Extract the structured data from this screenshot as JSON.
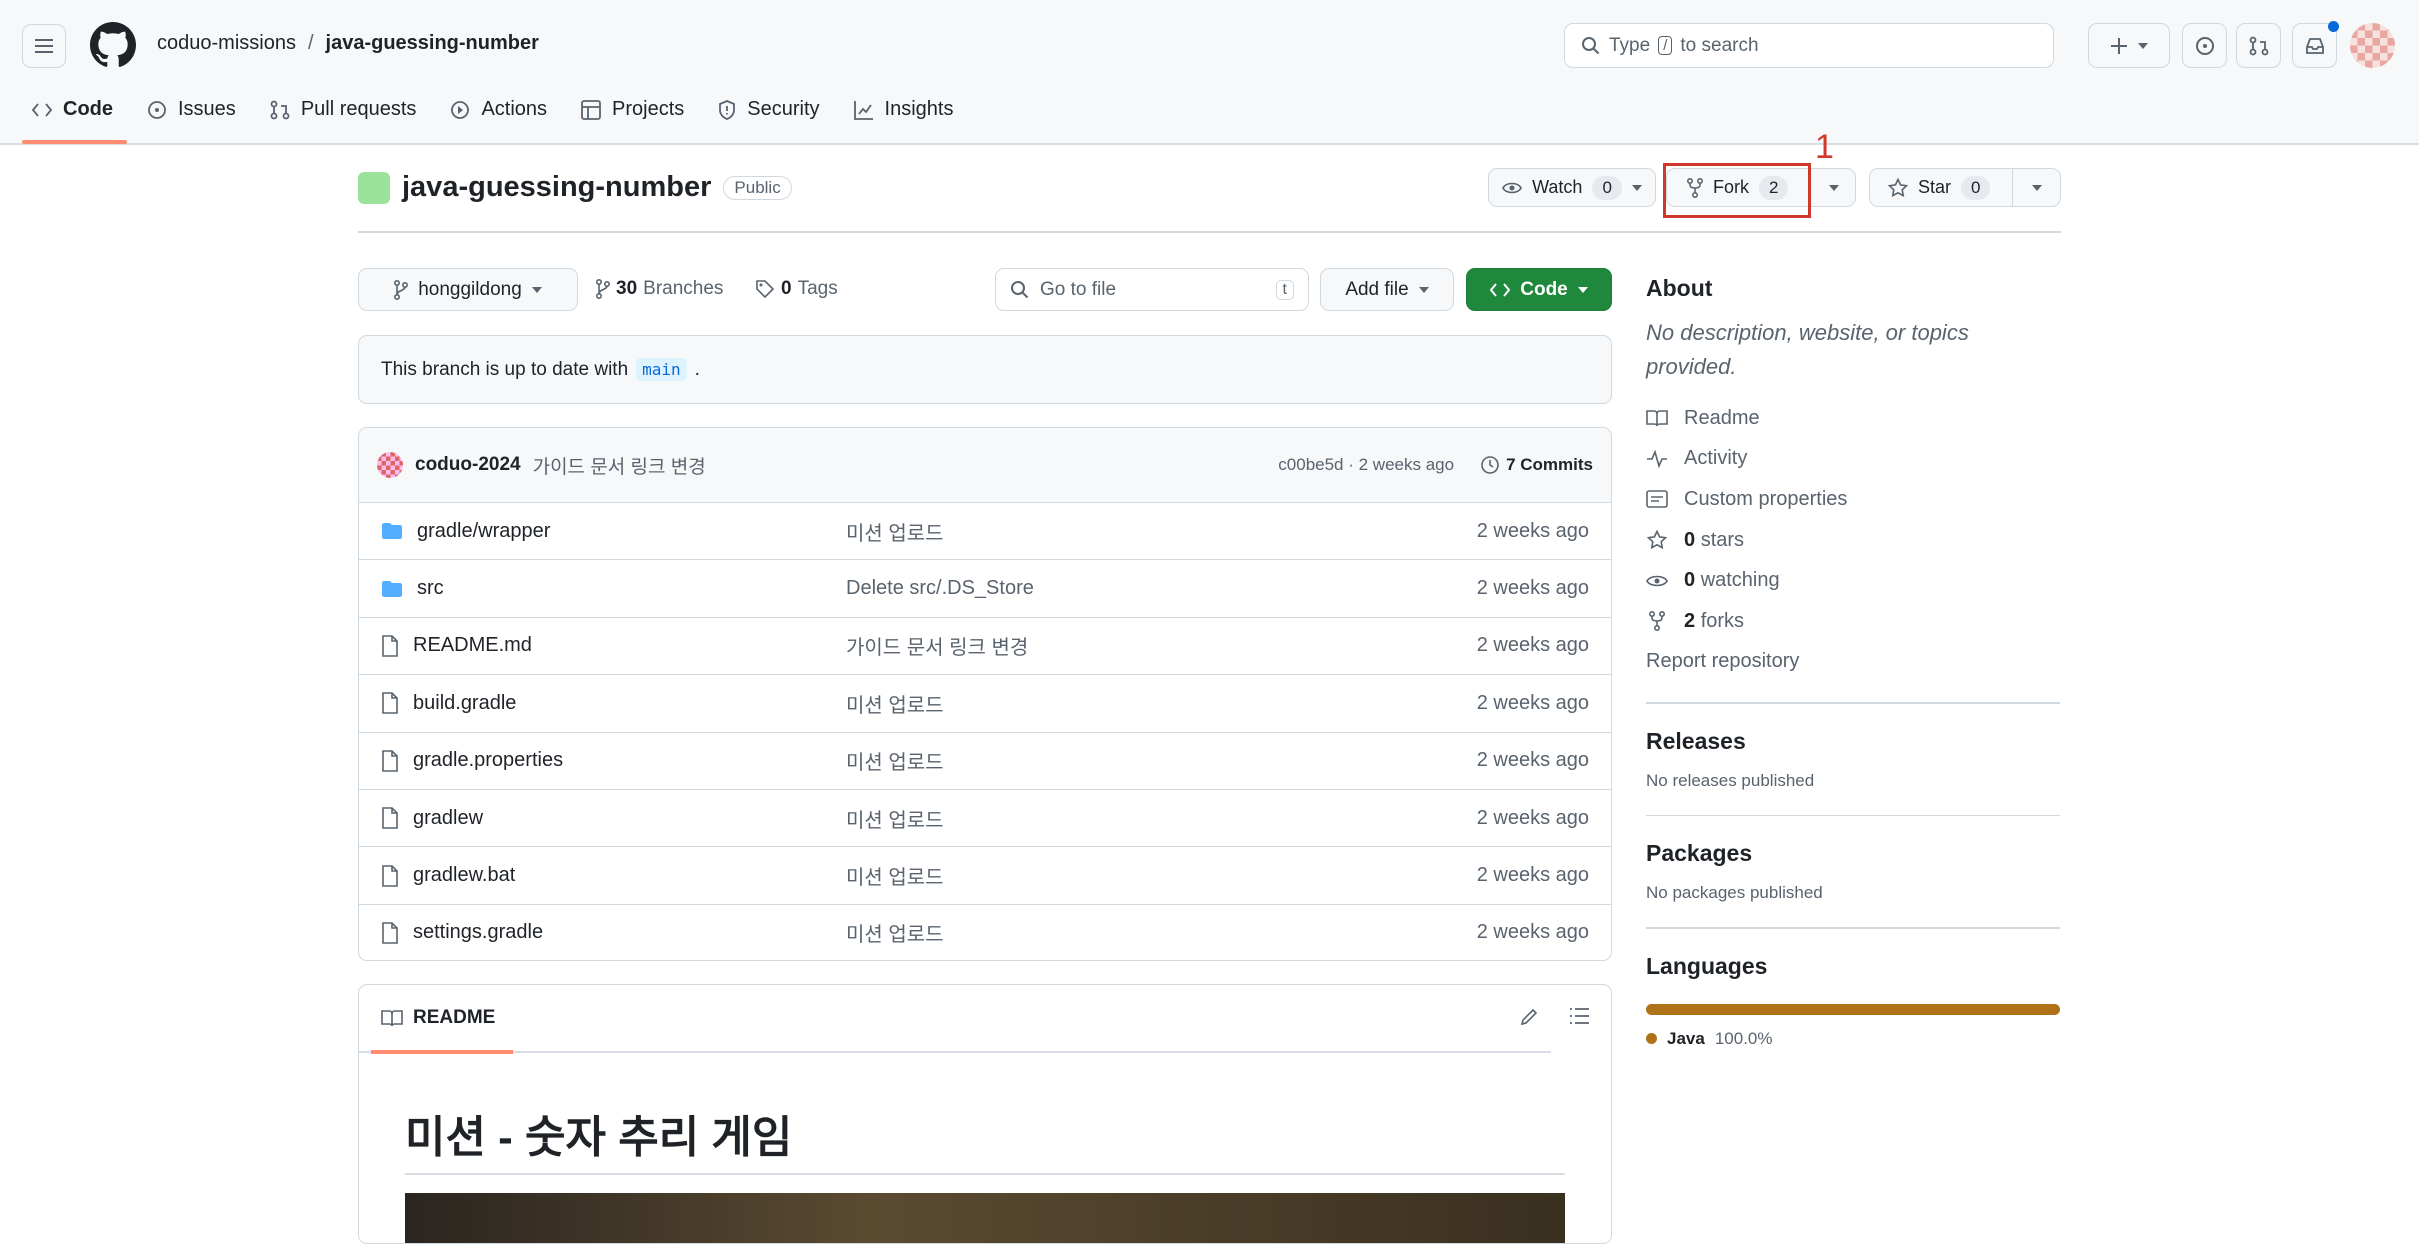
{
  "header": {
    "owner": "coduo-missions",
    "separator": "/",
    "repo": "java-guessing-number",
    "search_placeholder": "Type / to search",
    "search_prefix": "Type",
    "search_key": "/",
    "search_suffix": "to search"
  },
  "tabs": [
    {
      "label": "Code",
      "icon": "code-icon"
    },
    {
      "label": "Issues",
      "icon": "issue-icon"
    },
    {
      "label": "Pull requests",
      "icon": "pull-request-icon"
    },
    {
      "label": "Actions",
      "icon": "play-icon"
    },
    {
      "label": "Projects",
      "icon": "table-icon"
    },
    {
      "label": "Security",
      "icon": "shield-icon"
    },
    {
      "label": "Insights",
      "icon": "graph-icon"
    }
  ],
  "repo": {
    "name": "java-guessing-number",
    "visibility": "Public",
    "watch_label": "Watch",
    "watch_count": "0",
    "fork_label": "Fork",
    "fork_count": "2",
    "star_label": "Star",
    "star_count": "0",
    "annotation": "1",
    "highlight_color": "#d0382b"
  },
  "toolbar": {
    "branch": "honggildong",
    "branches_count": "30",
    "branches_label": "Branches",
    "tags_count": "0",
    "tags_label": "Tags",
    "goto_placeholder": "Go to file",
    "goto_key": "t",
    "add_file": "Add file",
    "code": "Code"
  },
  "banner": {
    "text": "This branch is up to date with",
    "branch": "main",
    "end": "."
  },
  "commit": {
    "author": "coduo-2024",
    "message": "가이드 문서 링크 변경",
    "hash_age": "c00be5d · 2 weeks ago",
    "commits": "7 Commits"
  },
  "files": [
    {
      "name": "gradle/wrapper",
      "type": "folder",
      "message": "미션 업로드",
      "age": "2 weeks ago"
    },
    {
      "name": "src",
      "type": "folder",
      "message": "Delete src/.DS_Store",
      "age": "2 weeks ago"
    },
    {
      "name": "README.md",
      "type": "file",
      "message": "가이드 문서 링크 변경",
      "age": "2 weeks ago"
    },
    {
      "name": "build.gradle",
      "type": "file",
      "message": "미션 업로드",
      "age": "2 weeks ago"
    },
    {
      "name": "gradle.properties",
      "type": "file",
      "message": "미션 업로드",
      "age": "2 weeks ago"
    },
    {
      "name": "gradlew",
      "type": "file",
      "message": "미션 업로드",
      "age": "2 weeks ago"
    },
    {
      "name": "gradlew.bat",
      "type": "file",
      "message": "미션 업로드",
      "age": "2 weeks ago"
    },
    {
      "name": "settings.gradle",
      "type": "file",
      "message": "미션 업로드",
      "age": "2 weeks ago"
    }
  ],
  "readme": {
    "tab": "README",
    "heading": "미션 - 숫자 추리 게임"
  },
  "about": {
    "title": "About",
    "description": "No description, website, or topics provided.",
    "readme": "Readme",
    "activity": "Activity",
    "custom": "Custom properties",
    "stars_n": "0",
    "stars": "stars",
    "watching_n": "0",
    "watching": "watching",
    "forks_n": "2",
    "forks": "forks",
    "report": "Report repository"
  },
  "releases": {
    "title": "Releases",
    "text": "No releases published"
  },
  "packages": {
    "title": "Packages",
    "text": "No packages published"
  },
  "languages": {
    "title": "Languages",
    "name": "Java",
    "percent": "100.0%",
    "java_fraction": 1.0,
    "java_color": "#b07219"
  }
}
